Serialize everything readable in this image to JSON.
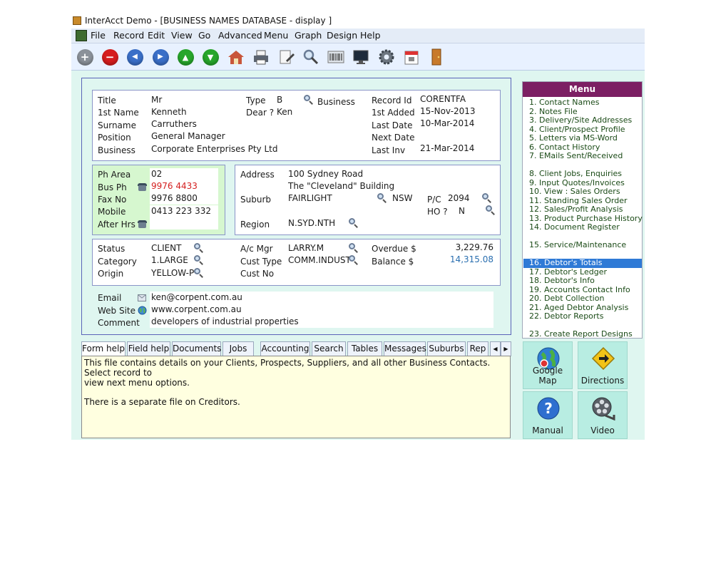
{
  "window": {
    "title": "InterAcct Demo - [BUSINESS NAMES DATABASE - display ]"
  },
  "menubar": [
    "File",
    "Record",
    "Edit",
    "View",
    "Go",
    "Advanced",
    "Menu",
    "Graph",
    "Design",
    "Help"
  ],
  "toolbar": {
    "add": "+",
    "delete": "−",
    "first": "◀",
    "last": "▶",
    "up": "▲",
    "down": "▼"
  },
  "name_panel": {
    "title_label": "Title",
    "title": "Mr",
    "firstname_label": "1st Name",
    "firstname": "Kenneth",
    "surname_label": "Surname",
    "surname": "Carruthers",
    "position_label": "Position",
    "position": "General Manager",
    "business_label": "Business",
    "business": "Corporate Enterprises Pty Ltd",
    "type_label": "Type",
    "type": "B",
    "type_desc": "Business",
    "dear_label": "Dear ?",
    "dear": "Ken",
    "recordid_label": "Record Id",
    "recordid": "CORENTFA",
    "firstadded_label": "1st Added",
    "firstadded": "15-Nov-2013",
    "lastdate_label": "Last Date",
    "lastdate": "10-Mar-2014",
    "nextdate_label": "Next Date",
    "nextdate": "",
    "lastinv_label": "Last Inv",
    "lastinv": "21-Mar-2014"
  },
  "phone_panel": {
    "pharea_label": "Ph Area",
    "pharea": "02",
    "busph_label": "Bus Ph",
    "busph": "9976 4433",
    "fax_label": "Fax No",
    "fax": "9976 8800",
    "mobile_label": "Mobile",
    "mobile": "0413 223 332",
    "afterhrs_label": "After Hrs",
    "afterhrs": ""
  },
  "address_panel": {
    "address_label": "Address",
    "address1": "100 Sydney Road",
    "address2": "The \"Cleveland\" Building",
    "suburb_label": "Suburb",
    "suburb": "FAIRLIGHT",
    "state": "NSW",
    "pc_label": "P/C",
    "pc": "2094",
    "ho_label": "HO ?",
    "ho": "N",
    "region_label": "Region",
    "region": "N.SYD.NTH"
  },
  "status_panel": {
    "status_label": "Status",
    "status": "CLIENT",
    "category_label": "Category",
    "category": "1.LARGE",
    "origin_label": "Origin",
    "origin": "YELLOW-P",
    "acmgr_label": "A/c Mgr",
    "acmgr": "LARRY.M",
    "custtype_label": "Cust Type",
    "custtype": "COMM.INDUST",
    "custno_label": "Cust No",
    "custno": "",
    "overdue_label": "Overdue $",
    "overdue": "3,229.76",
    "balance_label": "Balance $",
    "balance": "14,315.08"
  },
  "contact_panel": {
    "email_label": "Email",
    "email": "ken@corpent.com.au",
    "website_label": "Web Site",
    "website": "www.corpent.com.au",
    "comment_label": "Comment",
    "comment": "developers of industrial properties"
  },
  "tabs": [
    "Form help",
    "Field help",
    "Documents",
    "Jobs",
    "Accounting",
    "Search",
    "Tables",
    "Messages",
    "Suburbs",
    "Rep"
  ],
  "help": {
    "line1": "This file contains details on your Clients, Prospects, Suppliers, and all other Business Contacts.  Select record to",
    "line2": "view next menu options.",
    "line3": "There is a separate file on Creditors."
  },
  "menu": {
    "title": "Menu",
    "items": [
      "1. Contact Names",
      "2. Notes File",
      "3. Delivery/Site Addresses",
      "4. Client/Prospect Profile",
      "5. Letters via MS-Word",
      "6. Contact History",
      "7. EMails Sent/Received",
      "8. Client Jobs, Enquiries",
      "9. Input Quotes/Invoices",
      "10. View : Sales Orders",
      "11. Standing Sales Order",
      "12. Sales/Profit Analysis",
      "13. Product Purchase History",
      "14. Document Register",
      "15. Service/Maintenance",
      "16. Debtor's Totals",
      "17. Debtor's Ledger",
      "18. Debtor's Info",
      "19. Accounts Contact Info",
      "20. Debt Collection",
      "21. Aged Debtor Analysis",
      "22. Debtor Reports",
      "23. Create Report Designs"
    ],
    "selected": "16. Debtor's Totals"
  },
  "shortcuts": {
    "googlemap": "Google Map",
    "directions": "Directions",
    "manual": "Manual",
    "video": "Video"
  },
  "colors": {
    "busph": "#d42020",
    "balance": "#2a6fb0",
    "menu_header": "#7c1f63",
    "selection": "#2f7ad6"
  }
}
